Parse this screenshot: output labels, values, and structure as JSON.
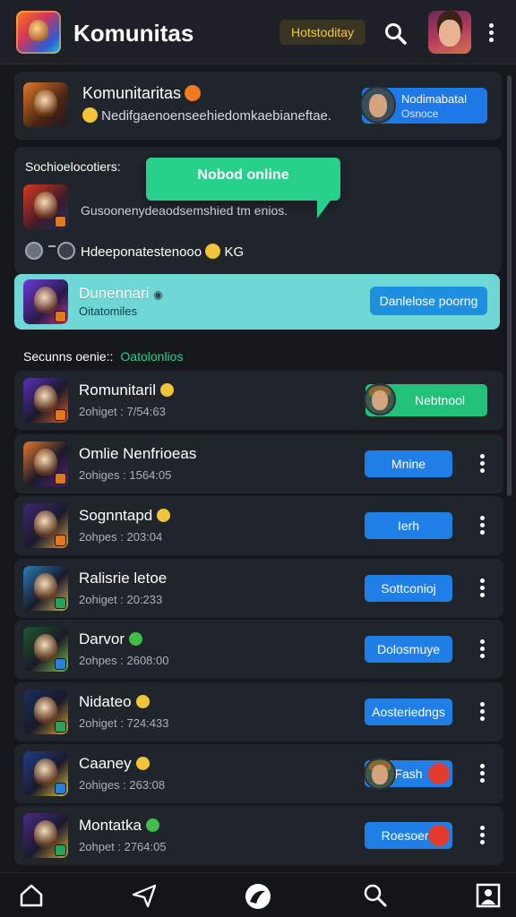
{
  "header": {
    "title": "Komunitas",
    "chip_label": "Hotstoditay"
  },
  "featured": {
    "title": "Komunitaritas",
    "description": "Nedifgaenoenseehiedomkaebianeftae.",
    "profile_line1": "Nodimabatal",
    "profile_line2": "Osnoce"
  },
  "section": {
    "label": "Sochioelocotiers:",
    "tooltip": "Nobod online",
    "description": "Gusoonenydeaodsemshied tm enios.",
    "status_text": "Hdeeponatestenooo",
    "status_suffix": "KG"
  },
  "highlight": {
    "title": "Dunennari",
    "subtitle": "Oitatomiles",
    "button": "Danlelose poorng"
  },
  "online_section": {
    "label": "Secunns oenie::",
    "link": "Oatolonlios"
  },
  "rows": [
    {
      "name": "Romunitaril",
      "meta": "2ohiget : 7/54:63",
      "button": "Nebtnool",
      "style": "green-avatar",
      "emoji": "y",
      "color1": "#5a2fb8",
      "color2": "#e05a2a"
    },
    {
      "name": "Omlie Nenfrioeas",
      "meta": "2ohiges : 1564:05",
      "button": "Mnine",
      "style": "blue",
      "emoji": "",
      "color1": "#e2782a",
      "color2": "#5b1f7a"
    },
    {
      "name": "Sognntapd",
      "meta": "2ohpes : 203:04",
      "button": "Ierh",
      "style": "blue",
      "emoji": "y",
      "color1": "#3d2a6e",
      "color2": "#d9a24a"
    },
    {
      "name": "Ralisrie letoe",
      "meta": "2ohiget : 20:233",
      "button": "Sottconioj",
      "style": "blue",
      "emoji": "",
      "color1": "#2a7db8",
      "color2": "#d9b15a"
    },
    {
      "name": "Darvor",
      "meta": "2ohpes : 2608:00",
      "button": "Dolosmuye",
      "style": "blue",
      "emoji": "g",
      "color1": "#1e5a2a",
      "color2": "#7acb3a"
    },
    {
      "name": "Nidateo",
      "meta": "2ohiget : 724:433",
      "button": "Aosteriedngs",
      "style": "blue",
      "emoji": "y",
      "color1": "#1a2e5a",
      "color2": "#e0a02a"
    },
    {
      "name": "Caaney",
      "meta": "2ohiges : 263:08",
      "button": "Fash",
      "style": "blue-avatar-red",
      "emoji": "y",
      "color1": "#1f3f8a",
      "color2": "#e6c23a"
    },
    {
      "name": "Montatka",
      "meta": "2ohpet : 2764:05",
      "button": "Roesoere",
      "style": "blue-red",
      "emoji": "g",
      "color1": "#4a2a8a",
      "color2": "#d8a23a"
    }
  ],
  "bottom_nav": [
    "home-icon",
    "send-icon",
    "compass-icon",
    "search-person-icon",
    "profile-icon"
  ]
}
